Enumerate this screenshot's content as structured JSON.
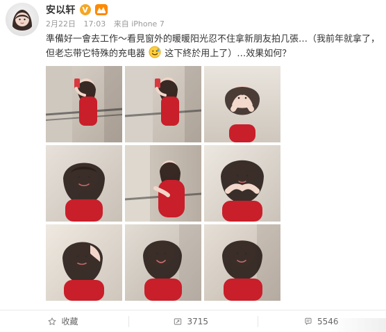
{
  "post": {
    "author": "安以轩",
    "meta": {
      "date": "2月22日",
      "time": "17:03",
      "via": "来自 iPhone 7"
    },
    "text_before_emoji": "準備好一會去工作～看見窗外的暖暖阳光忍不住拿新朋友拍几張…（我前年就拿了，但老忘带它特殊的充电器",
    "text_after_emoji": "这下終於用上了）…效果如何？"
  },
  "colors": {
    "name": "#333333",
    "meta": "#999999",
    "text": "#333333",
    "badge_v": "#f5a623",
    "badge_level": "#ff8a00",
    "action_text": "#666666"
  },
  "icons": {
    "verified_badge": "v-badge-icon",
    "level_badge": "level-badge-icon",
    "emoji": "sweat-smile-icon",
    "favorite": "star-outline-icon",
    "repost": "repost-icon",
    "comment": "comment-icon"
  },
  "badges": {
    "verified_label": "V"
  },
  "actions": [
    {
      "name": "favorite",
      "label": "收藏"
    },
    {
      "name": "repost",
      "label": "3715"
    },
    {
      "name": "comment",
      "label": "5546"
    }
  ],
  "image_grid": {
    "count": 9
  }
}
